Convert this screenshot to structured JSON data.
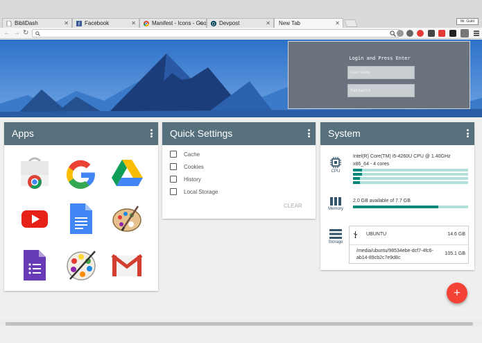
{
  "browser": {
    "tabs": [
      {
        "title": "BibliDash",
        "icon": "page-icon"
      },
      {
        "title": "Facebook",
        "icon": "facebook-icon"
      },
      {
        "title": "Manifest - Icons - Goo",
        "icon": "chrome-icon"
      },
      {
        "title": "Devpost",
        "icon": "devpost-icon"
      },
      {
        "title": "New Tab",
        "icon": ""
      }
    ],
    "profile_badge": "Mr. Guild",
    "address": ""
  },
  "login": {
    "title": "Login and Press Enter",
    "username_placeholder": "Username",
    "password_placeholder": "Password"
  },
  "apps": {
    "title": "Apps",
    "items": [
      {
        "name": "Chrome Web Store"
      },
      {
        "name": "Google"
      },
      {
        "name": "Google Drive"
      },
      {
        "name": "YouTube"
      },
      {
        "name": "Google Docs"
      },
      {
        "name": "Paint"
      },
      {
        "name": "Google Forms"
      },
      {
        "name": "Palette"
      },
      {
        "name": "Gmail"
      }
    ]
  },
  "quick_settings": {
    "title": "Quick Settings",
    "options": [
      "Cache",
      "Cookies",
      "History",
      "Local Storage"
    ],
    "clear_label": "CLEAR"
  },
  "system": {
    "title": "System",
    "cpu": {
      "label": "CPU",
      "name": "Intel(R) Core(TM) i5-4260U CPU @ 1.40GHz",
      "arch": "x86_64 - 4 cores",
      "core_usage": [
        0.08,
        0.08,
        0.06,
        0.06
      ]
    },
    "memory": {
      "label": "Memory",
      "text": "2.0 GB available of 7.7 GB",
      "used_fraction": 0.74
    },
    "storage": {
      "label": "Storage",
      "device": "UBUNTU",
      "device_size": "14.6 GB",
      "path": "/media/ubuntu/98534ebe-dcf7-4fc6-ab14-89cb2c7e9d8c",
      "path_size": "105.1 GB"
    }
  },
  "colors": {
    "header": "#57707d",
    "accent": "#00897b",
    "fab": "#f44336"
  },
  "fab_label": "+"
}
